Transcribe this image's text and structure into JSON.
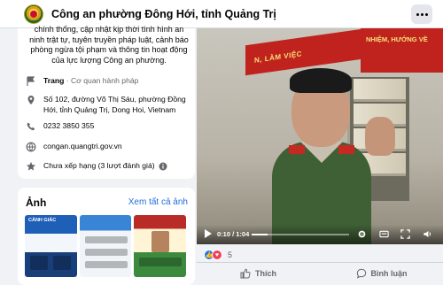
{
  "header": {
    "title": "Công an phường Đông Hới, tỉnh Quảng Trị",
    "more_icon": "more-horizontal-icon"
  },
  "intro": {
    "text": "chính thống, cập nhật kịp thời tình hình an ninh trật tự, tuyên truyền pháp luật, cảnh báo phòng ngừa tội phạm và thông tin hoạt động của lực lượng Công an phường.",
    "category_label": "Trang",
    "category_value": " · Cơ quan hành pháp",
    "address": "Số 102, đường Võ Thị Sáu, phường Đồng Hới, tỉnh Quảng Trị, Dong Hoi, Vietnam",
    "phone": "0232 3850 355",
    "website": "congan.quangtri.gov.vn",
    "rating": "Chưa xếp hạng (3 lượt đánh giá)"
  },
  "photos": {
    "heading": "Ảnh",
    "see_all": "Xem tất cả ảnh",
    "thumbs": [
      "CẢNH GIÁC",
      "",
      ""
    ]
  },
  "video": {
    "banner_left": "N, LÀM VIỆC",
    "banner_right": "NHIỆM, HƯỚNG VỀ",
    "time": "0:10 / 1:04",
    "progress": 0.16
  },
  "engagement": {
    "reaction_count": "5",
    "like_label": "Thích",
    "comment_label": "Bình luận"
  },
  "colors": {
    "accent": "#1877f2",
    "link": "#216fdb",
    "banner": "#c0231d"
  }
}
